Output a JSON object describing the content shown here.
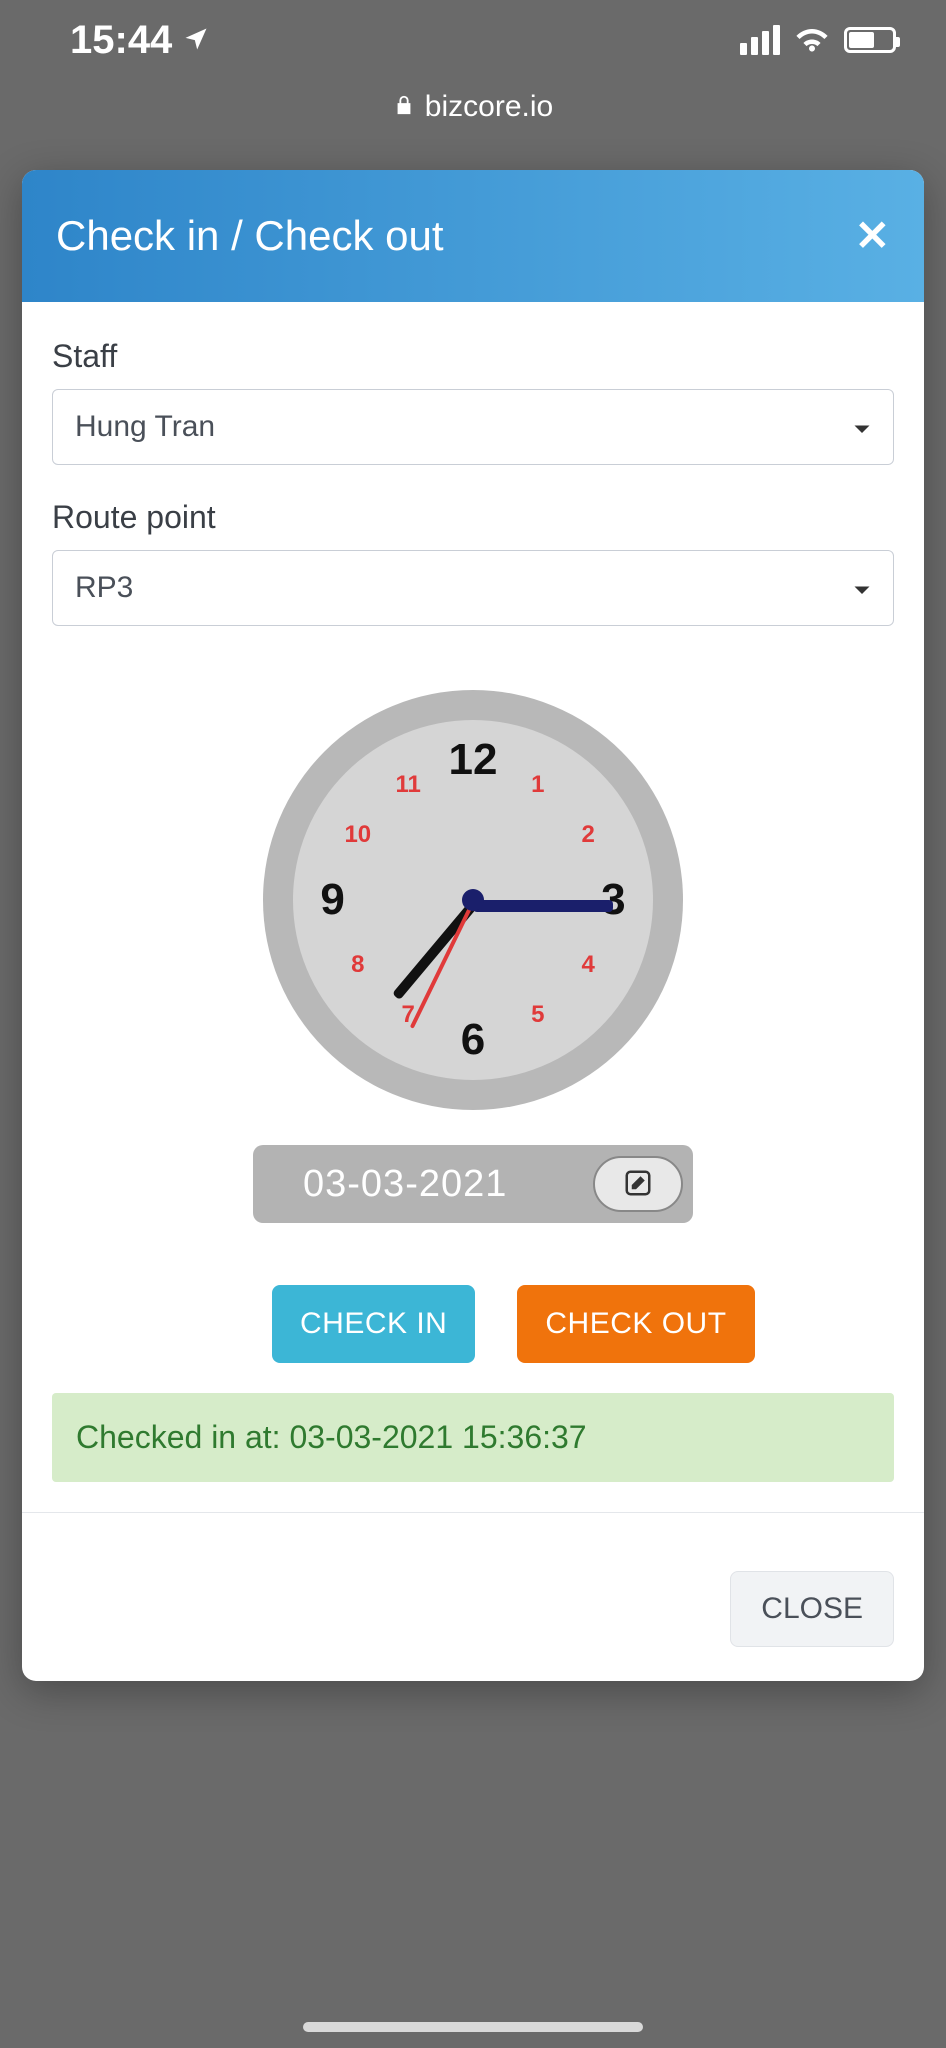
{
  "status_bar": {
    "time": "15:44"
  },
  "url": "bizcore.io",
  "modal": {
    "title": "Check in / Check out",
    "staff_label": "Staff",
    "staff_value": "Hung Tran",
    "route_label": "Route point",
    "route_value": "RP3",
    "date_value": "03-03-2021",
    "checkin_label": "CHECK IN",
    "checkout_label": "CHECK OUT",
    "status_text": "Checked in at: 03-03-2021 15:36:37",
    "close_label": "CLOSE"
  },
  "clock": {
    "numbers_big": {
      "n12": "12",
      "n3": "3",
      "n6": "6",
      "n9": "9"
    },
    "numbers_sm": {
      "n1": "1",
      "n2": "2",
      "n4": "4",
      "n5": "5",
      "n7": "7",
      "n8": "8",
      "n10": "10",
      "n11": "11"
    },
    "hour_angle": 0,
    "minute_angle": 130,
    "second_angle": 116
  }
}
